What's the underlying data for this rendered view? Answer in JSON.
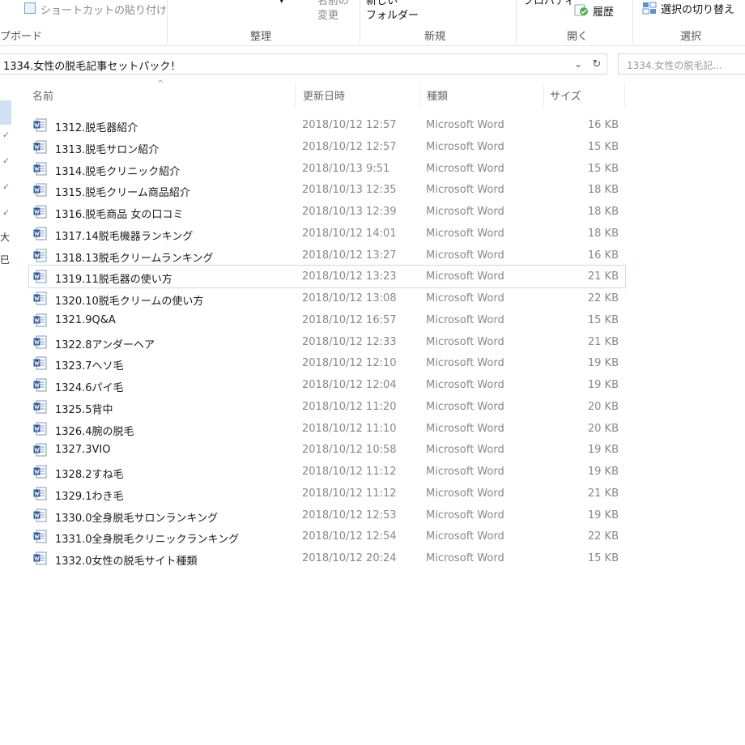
{
  "ribbon": {
    "paste_shortcut": "ショートカットの貼り付け",
    "clipboard_label": "プボード",
    "move_faint": "~ ~ ~ ~ ~ ~",
    "rename_line1": "名前の",
    "rename_line2": "変更",
    "organize_label": "整理",
    "new_folder_line1": "新しい",
    "new_folder_line2": "フォルダー",
    "new_label": "新規",
    "properties_partial": "プロパティ",
    "history_label": "履歴",
    "open_label": "開く",
    "select_toggle": "選択の切り替え",
    "select_label": "選択"
  },
  "address": {
    "path": "1334.女性の脱毛記事セットパック！",
    "chevron": "⌄",
    "refresh": "↻"
  },
  "search": {
    "placeholder": "1334.女性の脱毛記..."
  },
  "nav": {
    "pin": "✓",
    "label_a": "大",
    "label_b": "巳"
  },
  "columns": {
    "name": "名前",
    "date": "更新日時",
    "type": "種類",
    "size": "サイズ",
    "sort": "^"
  },
  "files": [
    {
      "name": "1312.脱毛器紹介",
      "date": "2018/10/12 12:57",
      "type": "Microsoft Word",
      "size": "16 KB"
    },
    {
      "name": "1313.脱毛サロン紹介",
      "date": "2018/10/12 12:57",
      "type": "Microsoft Word",
      "size": "15 KB"
    },
    {
      "name": "1314.脱毛クリニック紹介",
      "date": "2018/10/13 9:51",
      "type": "Microsoft Word",
      "size": "15 KB"
    },
    {
      "name": "1315.脱毛クリーム商品紹介",
      "date": "2018/10/13 12:35",
      "type": "Microsoft Word",
      "size": "18 KB"
    },
    {
      "name": "1316.脱毛商品 女の口コミ",
      "date": "2018/10/13 12:39",
      "type": "Microsoft Word",
      "size": "18 KB"
    },
    {
      "name": "1317.14脱毛機器ランキング",
      "date": "2018/10/12 14:01",
      "type": "Microsoft Word",
      "size": "18 KB"
    },
    {
      "name": "1318.13脱毛クリームランキング",
      "date": "2018/10/12 13:27",
      "type": "Microsoft Word",
      "size": "16 KB"
    },
    {
      "name": "1319.11脱毛器の使い方",
      "date": "2018/10/12 13:23",
      "type": "Microsoft Word",
      "size": "21 KB"
    },
    {
      "name": "1320.10脱毛クリームの使い方",
      "date": "2018/10/12 13:08",
      "type": "Microsoft Word",
      "size": "22 KB"
    },
    {
      "name": "1321.9Q&A",
      "date": "2018/10/12 16:57",
      "type": "Microsoft Word",
      "size": "15 KB"
    },
    {
      "name": "1322.8アンダーヘア",
      "date": "2018/10/12 12:33",
      "type": "Microsoft Word",
      "size": "21 KB"
    },
    {
      "name": "1323.7ヘソ毛",
      "date": "2018/10/12 12:10",
      "type": "Microsoft Word",
      "size": "19 KB"
    },
    {
      "name": "1324.6パイ毛",
      "date": "2018/10/12 12:04",
      "type": "Microsoft Word",
      "size": "19 KB"
    },
    {
      "name": "1325.5背中",
      "date": "2018/10/12 11:20",
      "type": "Microsoft Word",
      "size": "20 KB"
    },
    {
      "name": "1326.4腕の脱毛",
      "date": "2018/10/12 11:10",
      "type": "Microsoft Word",
      "size": "20 KB"
    },
    {
      "name": "1327.3VIO",
      "date": "2018/10/12 10:58",
      "type": "Microsoft Word",
      "size": "19 KB"
    },
    {
      "name": "1328.2すね毛",
      "date": "2018/10/12 11:12",
      "type": "Microsoft Word",
      "size": "19 KB"
    },
    {
      "name": "1329.1わき毛",
      "date": "2018/10/12 11:12",
      "type": "Microsoft Word",
      "size": "21 KB"
    },
    {
      "name": "1330.0全身脱毛サロンランキング",
      "date": "2018/10/12 12:53",
      "type": "Microsoft Word",
      "size": "19 KB"
    },
    {
      "name": "1331.0全身脱毛クリニックランキング",
      "date": "2018/10/12 12:54",
      "type": "Microsoft Word",
      "size": "22 KB"
    },
    {
      "name": "1332.0女性の脱毛サイト種類",
      "date": "2018/10/12 20:24",
      "type": "Microsoft Word",
      "size": "15 KB"
    }
  ],
  "highlighted_index": 7,
  "colors": {
    "selection_outline": "#c5dcf3",
    "word_icon": "#2b579a"
  }
}
